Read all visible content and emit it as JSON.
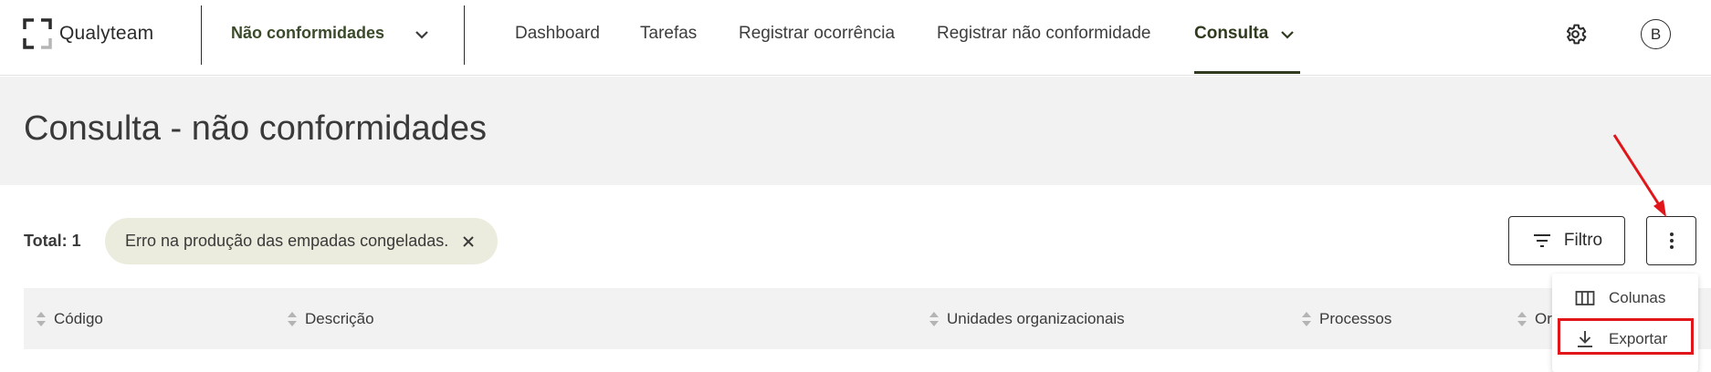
{
  "app": {
    "name": "Qualyteam"
  },
  "module": {
    "label": "Não conformidades"
  },
  "nav": {
    "items": [
      "Dashboard",
      "Tarefas",
      "Registrar ocorrência",
      "Registrar não conformidade",
      "Consulta"
    ],
    "active": "Consulta"
  },
  "user": {
    "initial": "B"
  },
  "page": {
    "title": "Consulta - não conformidades"
  },
  "toolbar": {
    "total_label": "Total: 1",
    "chip_label": "Erro na produção das empadas congeladas.",
    "filter_label": "Filtro"
  },
  "table": {
    "columns": [
      "Código",
      "Descrição",
      "Unidades organizacionais",
      "Processos",
      "Or"
    ]
  },
  "menu": {
    "items": [
      "Colunas",
      "Exportar"
    ],
    "highlighted": "Exportar"
  },
  "colors": {
    "accent": "#2f3a1f",
    "chip_bg": "#ececde",
    "header_bg": "#f2f2f2",
    "annotation": "#e0161b"
  },
  "icons": [
    "logo-icon",
    "chevron-down-icon",
    "gear-icon",
    "close-icon",
    "filter-icon",
    "more-vertical-icon",
    "sort-icon",
    "columns-icon",
    "download-icon"
  ]
}
